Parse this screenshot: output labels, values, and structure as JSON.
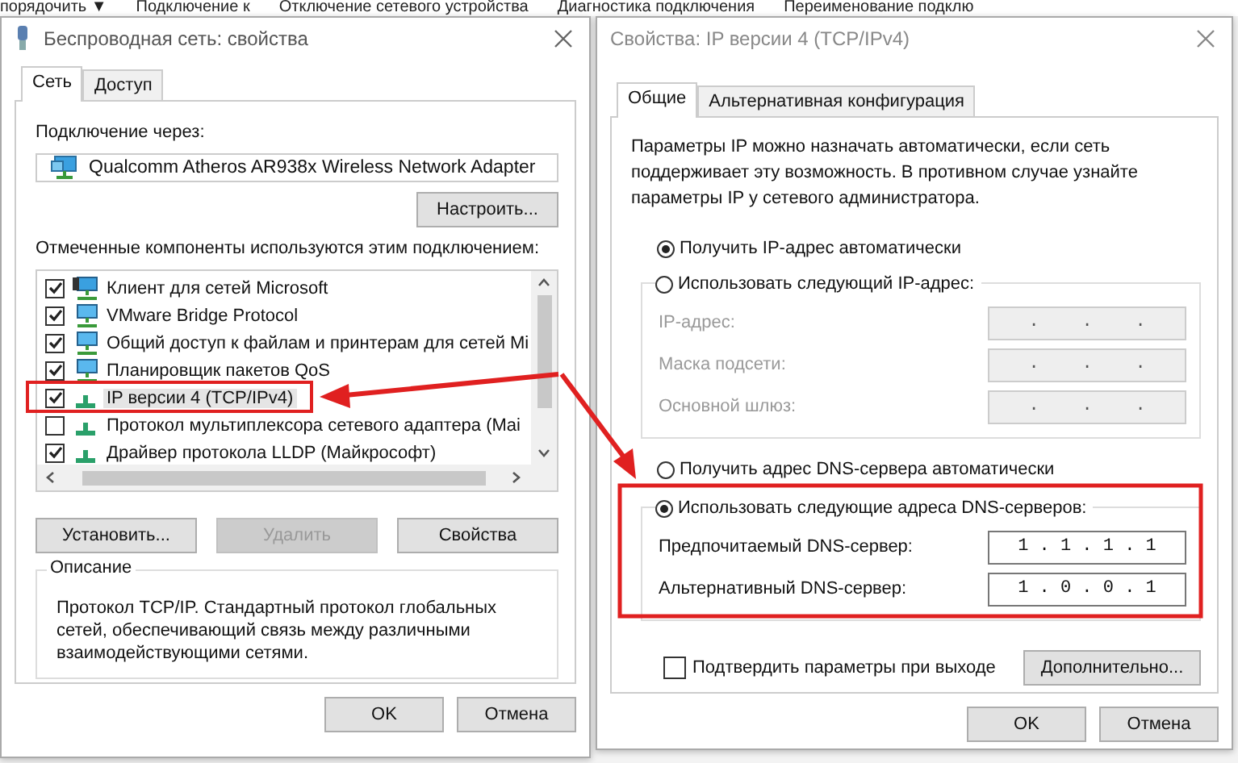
{
  "background_toolbar": [
    "порядочить ▼",
    "Подключение к",
    "Отключение сетевого устройства",
    "Диагностика подключения",
    "Переименование подклю"
  ],
  "left_dialog": {
    "title": "Беспроводная сеть: свойства",
    "tabs": [
      {
        "label": "Сеть",
        "selected": true
      },
      {
        "label": "Доступ",
        "selected": false
      }
    ],
    "connect_label": "Подключение через:",
    "adapter": "Qualcomm Atheros AR938x Wireless Network Adapter",
    "configure_button": "Настроить...",
    "components_label": "Отмеченные компоненты используются этим подключением:",
    "components": [
      {
        "kind": "client",
        "name": "Клиент для сетей Microsoft",
        "checked": true,
        "selected": false
      },
      {
        "kind": "service",
        "name": "VMware Bridge Protocol",
        "checked": true,
        "selected": false
      },
      {
        "kind": "service",
        "name": "Общий доступ к файлам и принтерам для сетей Mi",
        "checked": true,
        "selected": false
      },
      {
        "kind": "service",
        "name": "Планировщик пакетов QoS",
        "checked": true,
        "selected": false
      },
      {
        "kind": "protocol",
        "name": "IP версии 4 (TCP/IPv4)",
        "checked": true,
        "selected": true
      },
      {
        "kind": "protocol",
        "name": "Протокол мультиплексора сетевого адаптера (Mai",
        "checked": false,
        "selected": false
      },
      {
        "kind": "protocol",
        "name": "Драйвер протокола LLDP (Майкрософт)",
        "checked": true,
        "selected": false
      }
    ],
    "action_buttons": [
      {
        "label": "Установить...",
        "disabled": false
      },
      {
        "label": "Удалить",
        "disabled": true
      },
      {
        "label": "Свойства",
        "disabled": false
      }
    ],
    "description_title": "Описание",
    "description": "Протокол TCP/IP. Стандартный протокол глобальных сетей, обеспечивающий связь между различными взаимодействующими сетями.",
    "buttons": [
      "OK",
      "Отмена"
    ]
  },
  "right_dialog": {
    "title": "Свойства: IP версии 4 (TCP/IPv4)",
    "tabs": [
      {
        "label": "Общие",
        "selected": true
      },
      {
        "label": "Альтернативная конфигурация",
        "selected": false
      }
    ],
    "intro": "Параметры IP можно назначать автоматически, если сеть поддерживает эту возможность. В противном случае узнайте параметры IP у сетевого администратора.",
    "ip_auto": {
      "label": "Получить IP-адрес автоматически",
      "selected": true
    },
    "ip_manual": {
      "label": "Использовать следующий IP-адрес:",
      "selected": false
    },
    "ip_fields": [
      {
        "label": "IP-адрес:",
        "value": ".    .    .",
        "disabled": true
      },
      {
        "label": "Маска подсети:",
        "value": ".    .    .",
        "disabled": true
      },
      {
        "label": "Основной шлюз:",
        "value": ".    .    .",
        "disabled": true
      }
    ],
    "dns_auto": {
      "label": "Получить адрес DNS-сервера автоматически",
      "selected": false
    },
    "dns_manual": {
      "label": "Использовать следующие адреса DNS-серверов:",
      "selected": true
    },
    "dns_fields": [
      {
        "label": "Предпочитаемый DNS-сервер:",
        "value": "1 . 1 . 1 . 1",
        "disabled": false
      },
      {
        "label": "Альтернативный DNS-сервер:",
        "value": "1 . 0 . 0 . 1",
        "disabled": false
      }
    ],
    "validate": {
      "label": "Подтвердить параметры при выходе",
      "checked": false
    },
    "advanced_button": "Дополнительно...",
    "buttons": [
      "OK",
      "Отмена"
    ]
  }
}
